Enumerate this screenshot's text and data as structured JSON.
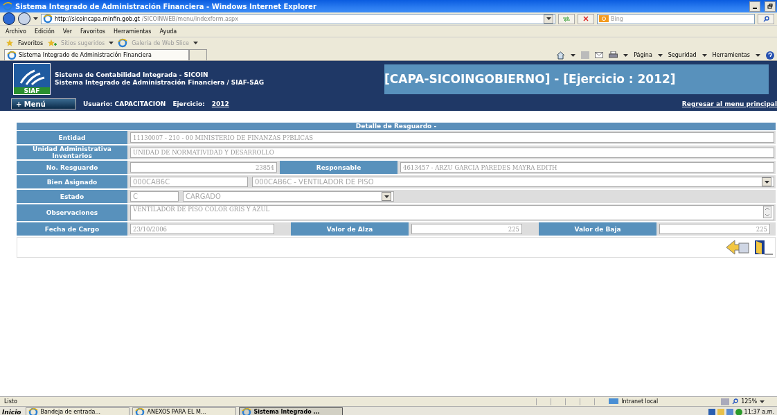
{
  "window": {
    "title": "Sistema Integrado de Administración Financiera - Windows Internet Explorer"
  },
  "browser": {
    "address_host": "http://sicoincapa.minfin.gob.gt",
    "address_path": "/SICOINWEB/menu/indexform.aspx",
    "search_placeholder": "Bing",
    "menu": [
      "Archivo",
      "Edición",
      "Ver",
      "Favoritos",
      "Herramientas",
      "Ayuda"
    ],
    "favorites": [
      {
        "label": "Favoritos",
        "disabled": false
      },
      {
        "label": "Sitios sugeridos",
        "disabled": true
      },
      {
        "label": "Galería de Web Slice",
        "disabled": true
      }
    ],
    "tab": "Sistema Integrado de Administración Financiera",
    "commands": [
      "Página",
      "Seguridad",
      "Herramientas"
    ]
  },
  "header": {
    "logo_text": "SIAF",
    "lines": [
      "Sistema de Contabilidad Integrada - SICOIN",
      "Sistema Integrado de Administración Financiera / SIAF-SAG"
    ],
    "banner": "[CAPA-SICOINGOBIERNO] - [Ejercicio : 2012]",
    "menu_button": "+ Menú",
    "user": "Usuario: CAPACITACION",
    "year_label": "Ejercicio:",
    "year": "2012",
    "back_link": "Regresar al menu principal"
  },
  "form": {
    "title": "Detalle de Resguardo -",
    "rows": [
      [
        {
          "kind": "label",
          "text": "Entidad"
        },
        {
          "kind": "text",
          "value": "11130007 - 210 - 00 MINISTERIO DE FINANZAS P?BLICAS"
        }
      ],
      [
        {
          "kind": "label",
          "text": "Unidad Administrativa Inventarios"
        },
        {
          "kind": "text",
          "value": "UNIDAD DE NORMATIVIDAD Y DESARROLLO"
        }
      ],
      [
        {
          "kind": "label",
          "text": "No. Resguardo"
        },
        {
          "kind": "number",
          "value": "23854"
        },
        {
          "kind": "label",
          "text": "Responsable"
        },
        {
          "kind": "text",
          "value": "4613457 - ARZU GARCIA PAREDES MAYRA EDITH"
        }
      ],
      [
        {
          "kind": "label",
          "text": "Bien Asignado"
        },
        {
          "kind": "code",
          "value": "000CAB6C"
        },
        {
          "kind": "select",
          "value": "000CAB6C - VENTILADOR DE PISO"
        }
      ],
      [
        {
          "kind": "label",
          "text": "Estado"
        },
        {
          "kind": "state",
          "value": "C"
        },
        {
          "kind": "short-select",
          "value": "CARGADO"
        },
        {
          "kind": "blank"
        }
      ],
      [
        {
          "kind": "label",
          "text": "Observaciones"
        },
        {
          "kind": "textarea",
          "value": "VENTILADOR DE PISO COLOR GRIS Y AZUL"
        }
      ],
      [
        {
          "kind": "label",
          "text": "Fecha de Cargo"
        },
        {
          "kind": "date",
          "value": "23/10/2006"
        },
        {
          "kind": "label",
          "text": "Valor de Alza"
        },
        {
          "kind": "amount",
          "value": "225"
        },
        {
          "kind": "label",
          "text": "Valor de Baja"
        },
        {
          "kind": "amount",
          "value": "225"
        }
      ]
    ]
  },
  "status_bar": {
    "text": "Listo",
    "zone": "Intranet local",
    "zoom": "125%"
  },
  "taskbar": {
    "start": "Inicio",
    "items": [
      {
        "label": "Bandeja de entrada...",
        "selected": false
      },
      {
        "label": "ANEXOS PARA EL M...",
        "selected": false
      },
      {
        "label": "Sistema Integrado ...",
        "selected": true
      }
    ],
    "clock": "11:37 a.m."
  }
}
